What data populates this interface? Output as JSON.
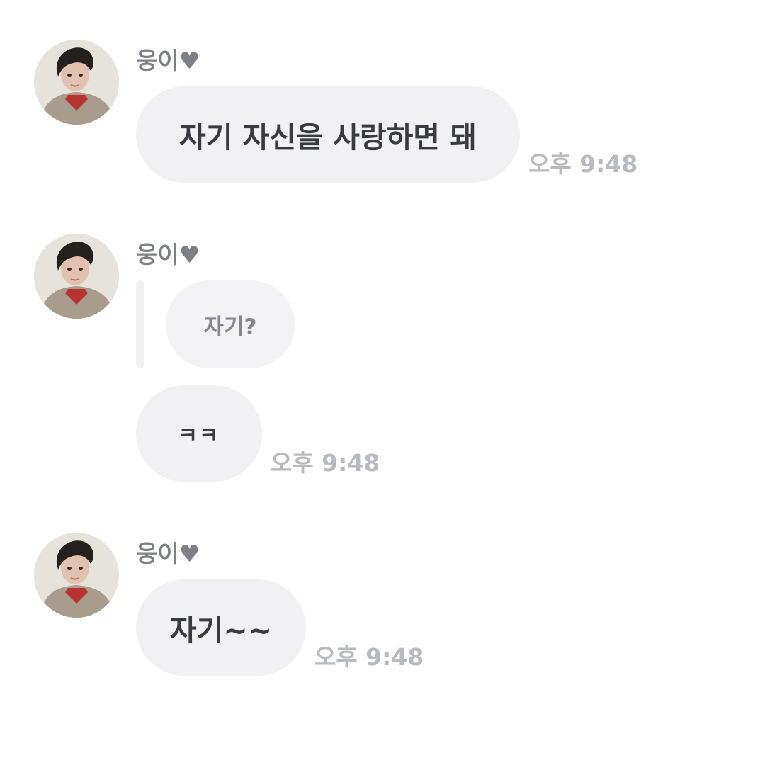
{
  "messages": [
    {
      "sender": "웅이♥",
      "text": "자기 자신을 사랑하면 돼",
      "time": "오후 9:48"
    },
    {
      "sender": "웅이♥",
      "reply_to": "자기?",
      "text": "ㅋㅋ",
      "time": "오후 9:48"
    },
    {
      "sender": "웅이♥",
      "text": "자기~~",
      "time": "오후 9:48"
    }
  ],
  "colors": {
    "bubble": "#f1f1f4",
    "sender_name": "#7d7f85",
    "timestamp": "#b8bac0",
    "message_text": "#3a3b40"
  },
  "icons": {
    "avatar": "profile-photo-avatar"
  }
}
